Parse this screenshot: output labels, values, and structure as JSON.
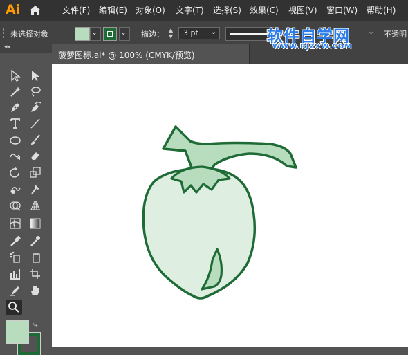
{
  "app": {
    "logo": "Ai"
  },
  "menu": [
    {
      "label": "文件(F)"
    },
    {
      "label": "编辑(E)"
    },
    {
      "label": "对象(O)"
    },
    {
      "label": "文字(T)"
    },
    {
      "label": "选择(S)"
    },
    {
      "label": "效果(C)"
    },
    {
      "label": "视图(V)"
    },
    {
      "label": "窗口(W)"
    },
    {
      "label": "帮助(H)"
    }
  ],
  "control_bar": {
    "selection_status": "未选择对象",
    "stroke_label": "描边：",
    "stroke_weight": "3 pt",
    "opacity_label": "不透明",
    "fill_color": "#b7dcbe",
    "stroke_color": "#1e6b36"
  },
  "watermark": {
    "title": "软件自学网",
    "url": "WWW.RJZXW.COM"
  },
  "document_tab": {
    "label": "菠萝图标.ai* @ 100% (CMYK/预览)"
  },
  "toolbar": {
    "collapse_glyph": "◂◂",
    "tools": [
      "selection-tool-icon",
      "direct-selection-tool-icon",
      "magic-wand-tool-icon",
      "lasso-tool-icon",
      "pen-tool-icon",
      "curvature-tool-icon",
      "type-tool-icon",
      "line-segment-tool-icon",
      "ellipse-tool-icon",
      "paintbrush-tool-icon",
      "shaper-tool-icon",
      "eraser-tool-icon",
      "rotate-tool-icon",
      "scale-tool-icon",
      "warp-tool-icon",
      "puppet-warp-tool-icon",
      "shape-builder-tool-icon",
      "perspective-grid-tool-icon",
      "mesh-tool-icon",
      "gradient-tool-icon",
      "eyedropper-tool-icon",
      "blend-tool-icon",
      "symbol-sprayer-tool-icon",
      "column-graph-tool-icon",
      "artboard-tool-icon",
      "slice-tool-icon",
      "hand-tool-icon",
      "zoom-tool-icon"
    ],
    "active_tool": "zoom-tool-icon",
    "fill_color": "#b7dcbe",
    "stroke_color": "#1e6b36"
  },
  "artwork": {
    "fill_light": "#deeee0",
    "fill_leaf": "#b7dcbe",
    "stroke": "#1e6b36"
  }
}
